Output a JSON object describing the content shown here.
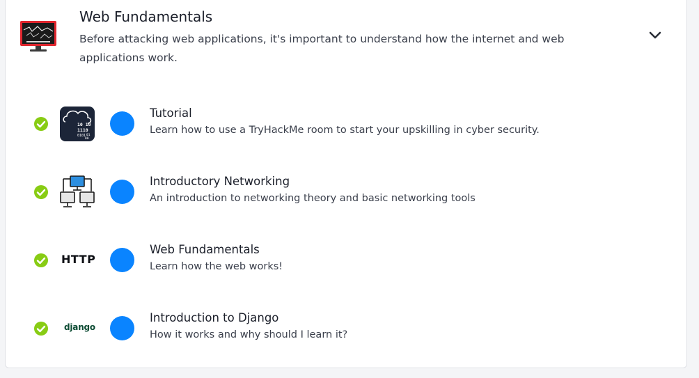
{
  "module": {
    "title": "Web Fundamentals",
    "description": "Before attacking web applications, it's important to understand how the internet and web applications work.",
    "icon": "monitor-lightning-icon",
    "expanded": true,
    "toggle_icon": "chevron-down-icon"
  },
  "rooms": [
    {
      "title": "Tutorial",
      "description": "Learn how to use a TryHackMe room to start your upskilling in cyber security.",
      "icon": "cloud-binary-icon",
      "icon_text": [
        "10 10",
        "1110",
        "0101",
        "01",
        "00"
      ],
      "completed": true
    },
    {
      "title": "Introductory Networking",
      "description": "An introduction to networking theory and basic networking tools",
      "icon": "network-computers-icon",
      "completed": true
    },
    {
      "title": "Web Fundamentals",
      "description": "Learn how the web works!",
      "icon": "http-icon",
      "icon_text": "HTTP",
      "completed": true
    },
    {
      "title": "Introduction to Django",
      "description": "How it works and why should I learn it?",
      "icon": "django-icon",
      "icon_text": "django",
      "completed": true
    }
  ],
  "colors": {
    "check_green": "#88cc14",
    "progress_blue": "#0a84ff",
    "icon_dark": "#1c2538"
  }
}
